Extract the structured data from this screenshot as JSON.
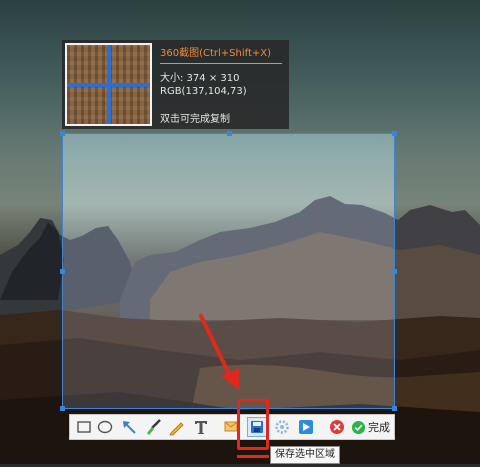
{
  "screenshot_tool": {
    "title": "360截图(Ctrl+Shift+X)",
    "size_text": "大小: 374 × 310",
    "rgb_text": "RGB(137,104,73)",
    "hint_text": "双击可完成复制"
  },
  "toolbar": {
    "tools": [
      "rectangle-tool",
      "ellipse-tool",
      "arrow-tool",
      "brush-tool",
      "pen-tool",
      "text-tool",
      "mosaic-tool",
      "save-tool",
      "settings-tool",
      "share-tool",
      "cancel-tool"
    ],
    "done_label": "完成",
    "save_tooltip": "保存选中区域"
  },
  "colors": {
    "selection_border": "#3a86d6",
    "title_accent": "#f08a3c",
    "highlight": "#e0281c",
    "done_green": "#2fb24a",
    "cancel_red": "#e03b3b"
  }
}
